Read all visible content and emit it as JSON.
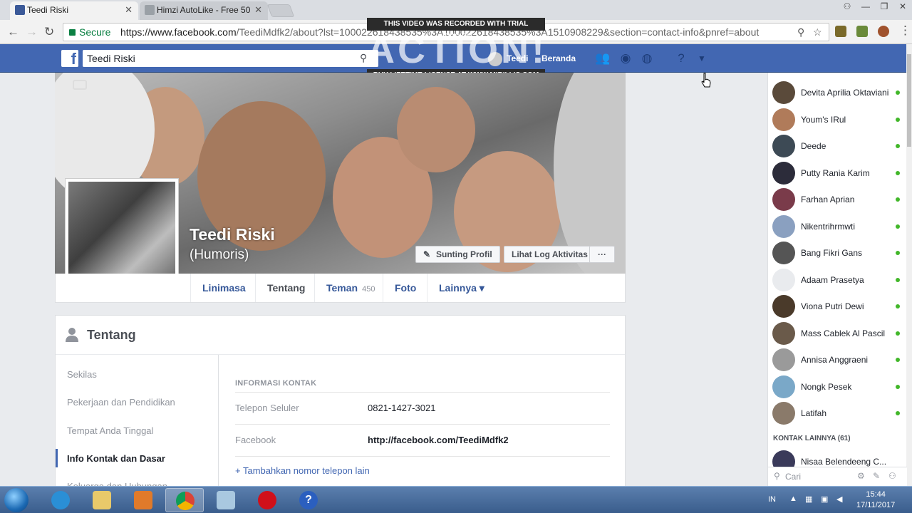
{
  "browser": {
    "tabs": [
      {
        "title": "Teedi Riski",
        "active": true
      },
      {
        "title": "Himzi AutoLike - Free 50",
        "active": false
      }
    ],
    "secure_label": "Secure",
    "url_host": "https://www.facebook.com",
    "url_rest": "/TeediMdfk2/about?lst=100022618438535%3A100022618438535%3A1510908229&section=contact-info&pnref=about"
  },
  "watermark": {
    "top": "THIS VIDEO WAS RECORDED WITH TRIAL VERSION",
    "logo": "ACTION!",
    "bottom": "BUY LIFETIME LICENSE AT WWW.MIRILLIS.COM"
  },
  "fb": {
    "search_value": "Teedi Riski",
    "user_name": "Teedi",
    "home_label": "Beranda"
  },
  "profile": {
    "name": "Teedi Riski",
    "alternate_name": "(Humoris)",
    "edit_button": "Sunting Profil",
    "activity_button": "Lihat Log Aktivitas",
    "more_button": "···",
    "tabs": [
      {
        "label": "Linimasa"
      },
      {
        "label": "Tentang"
      },
      {
        "label": "Teman",
        "count": "450"
      },
      {
        "label": "Foto"
      },
      {
        "label": "Lainnya ▾"
      }
    ]
  },
  "about": {
    "title": "Tentang",
    "nav": [
      "Sekilas",
      "Pekerjaan dan Pendidikan",
      "Tempat Anda Tinggal",
      "Info Kontak dan Dasar",
      "Keluarga dan Hubungan"
    ],
    "section_title": "INFORMASI KONTAK",
    "rows": [
      {
        "label": "Telepon Seluler",
        "value": "0821-1427-3021"
      },
      {
        "label": "Facebook",
        "value": "http://facebook.com/TeediMdfk2"
      }
    ],
    "add_phone": "Tambahkan nomor telepon lain"
  },
  "chat": {
    "contacts": [
      {
        "name": "Devita Aprilia Oktaviani",
        "color": "#5a4a3a"
      },
      {
        "name": "Youm's IRul",
        "color": "#b07b5a"
      },
      {
        "name": "Deede",
        "color": "#3d4a55"
      },
      {
        "name": "Putty Rania Karim",
        "color": "#2c2c3a"
      },
      {
        "name": "Farhan Aprian",
        "color": "#7a3b4a"
      },
      {
        "name": "Nikentrihrmwti",
        "color": "#8aa0c0"
      },
      {
        "name": "Bang Fikri Gans",
        "color": "#555555"
      },
      {
        "name": "Adaam Prasetya",
        "color": "#e9ebee"
      },
      {
        "name": "Viona Putri Dewi",
        "color": "#4a3a2a"
      },
      {
        "name": "Mass Cablek Al Pascil",
        "color": "#6a5a4a"
      },
      {
        "name": "Annisa Anggraeni",
        "color": "#9a9a9a"
      },
      {
        "name": "Nongk Pesek",
        "color": "#7aa8c8"
      },
      {
        "name": "Latifah",
        "color": "#8a7a6a"
      }
    ],
    "other_contacts_label": "KONTAK LAINNYA (61)",
    "other_first": "Nisaa Belendeeng C...",
    "search_placeholder": "Cari"
  },
  "taskbar": {
    "lang": "IN",
    "time": "15:44",
    "date": "17/11/2017"
  }
}
